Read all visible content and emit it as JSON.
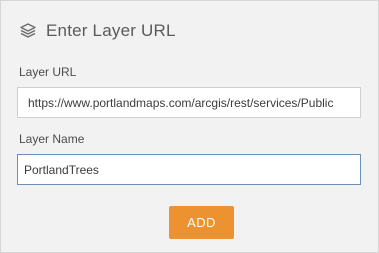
{
  "panel": {
    "title": "Enter Layer URL",
    "title_icon": "layers-icon"
  },
  "layer_url": {
    "label": "Layer URL",
    "value": "https://www.portlandmaps.com/arcgis/rest/services/Public"
  },
  "layer_name": {
    "label": "Layer Name",
    "value": "PortlandTrees"
  },
  "actions": {
    "add_label": "ADD"
  },
  "colors": {
    "panel_background": "#f2f2f2",
    "add_button": "#ec9230",
    "focused_border": "#6b8fb5"
  }
}
